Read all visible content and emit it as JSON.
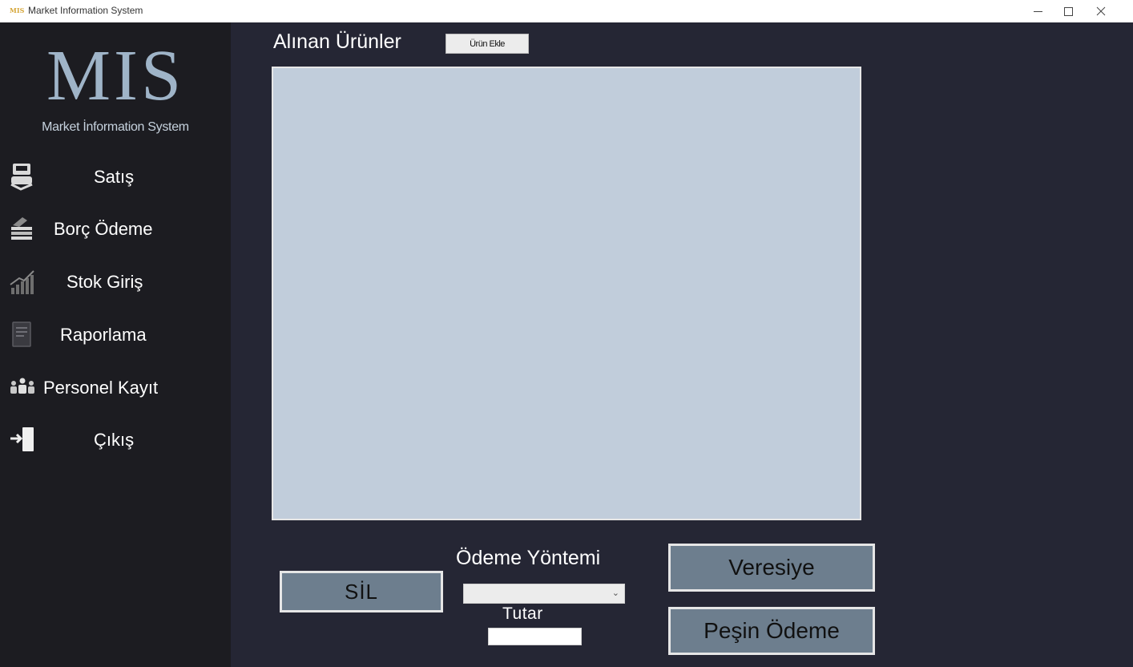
{
  "window": {
    "icon_text": "MIS",
    "title": "Market Information System",
    "minimize_icon": "minimize-icon",
    "maximize_icon": "maximize-icon",
    "close_icon": "close-icon"
  },
  "sidebar": {
    "logo": "MIS",
    "logo_subtitle": "Market İnformation System",
    "items": [
      {
        "label": "Satış",
        "icon": "cash-register-icon"
      },
      {
        "label": "Borç Ödeme",
        "icon": "money-stack-icon"
      },
      {
        "label": "Stok Giriş",
        "icon": "chart-growth-icon"
      },
      {
        "label": "Raporlama",
        "icon": "report-document-icon"
      },
      {
        "label": "Personel Kayıt",
        "icon": "people-group-icon"
      },
      {
        "label": "Çıkış",
        "icon": "exit-door-icon"
      }
    ]
  },
  "main": {
    "heading": "Alınan Ürünler",
    "add_button": "Ürün Ekle",
    "delete_button": "SİL",
    "payment_method_label": "Ödeme Yöntemi",
    "payment_method_value": "",
    "amount_label": "Tutar",
    "amount_value": "",
    "credit_button": "Veresiye",
    "cash_button": "Peşin Ödeme"
  },
  "colors": {
    "sidebar_bg": "#1c1c21",
    "main_bg": "#252634",
    "list_bg": "#c1cddb",
    "button_bg": "#6d7e8e",
    "logo_color": "#9fb4c8"
  }
}
